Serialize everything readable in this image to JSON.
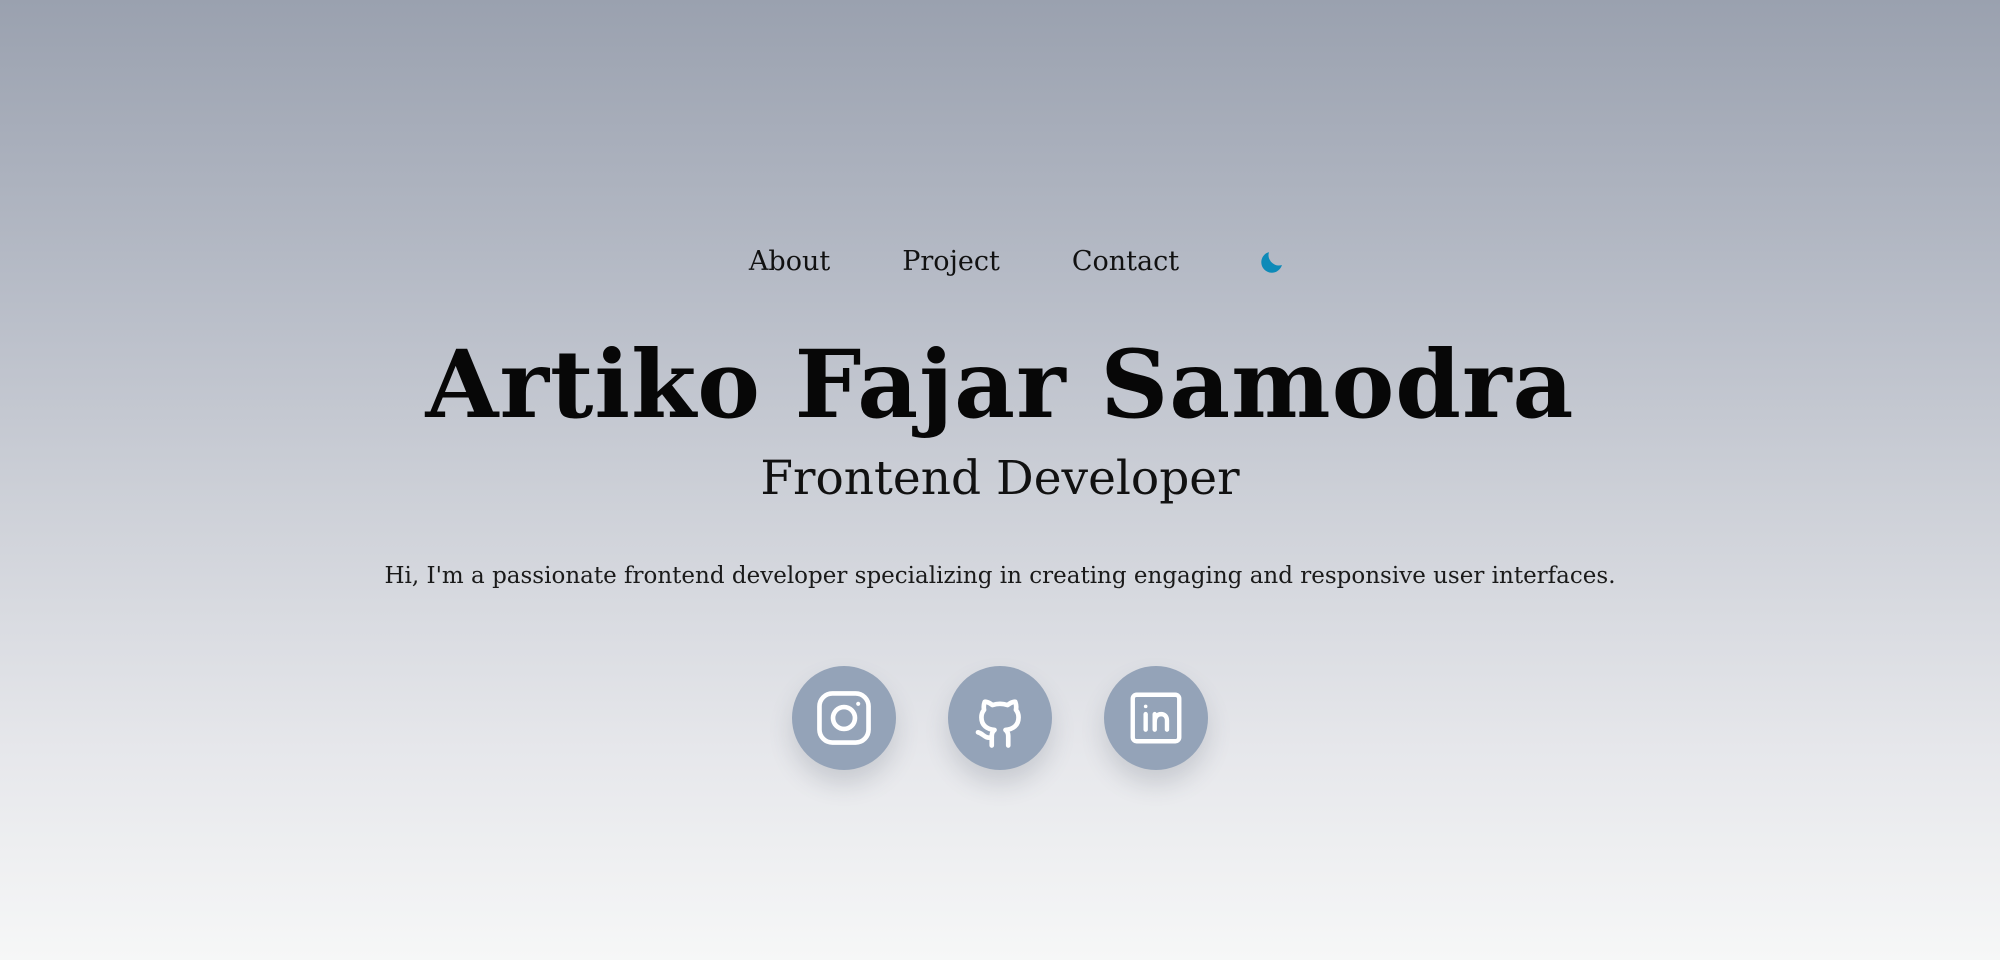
{
  "nav": {
    "items": [
      {
        "label": "About"
      },
      {
        "label": "Project"
      },
      {
        "label": "Contact"
      }
    ],
    "theme_toggle_icon": "moon-icon",
    "accent_color": "#0e8ab8"
  },
  "hero": {
    "name": "Artiko Fajar Samodra",
    "role": "Frontend Developer",
    "bio": "Hi, I'm a passionate frontend developer specializing in creating engaging and responsive user interfaces."
  },
  "socials": [
    {
      "icon": "instagram-icon"
    },
    {
      "icon": "github-icon"
    },
    {
      "icon": "linkedin-icon"
    }
  ],
  "colors": {
    "social_bg": "#94a3b8",
    "text": "#0b0b0b"
  }
}
